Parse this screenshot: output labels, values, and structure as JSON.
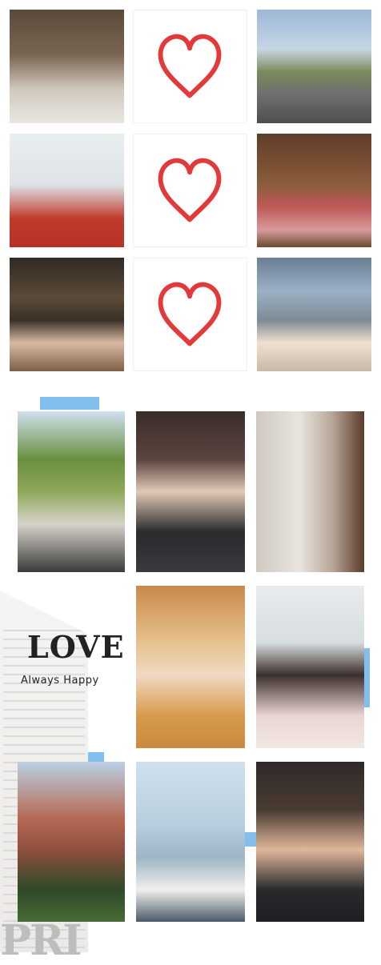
{
  "collage": {
    "love_title": "LOVE",
    "love_subtitle": "Always Happy",
    "bottom_letters": "PRI"
  },
  "heart": {
    "color": "#e23a3a"
  },
  "accent": {
    "blue": "#5aa9e6"
  }
}
